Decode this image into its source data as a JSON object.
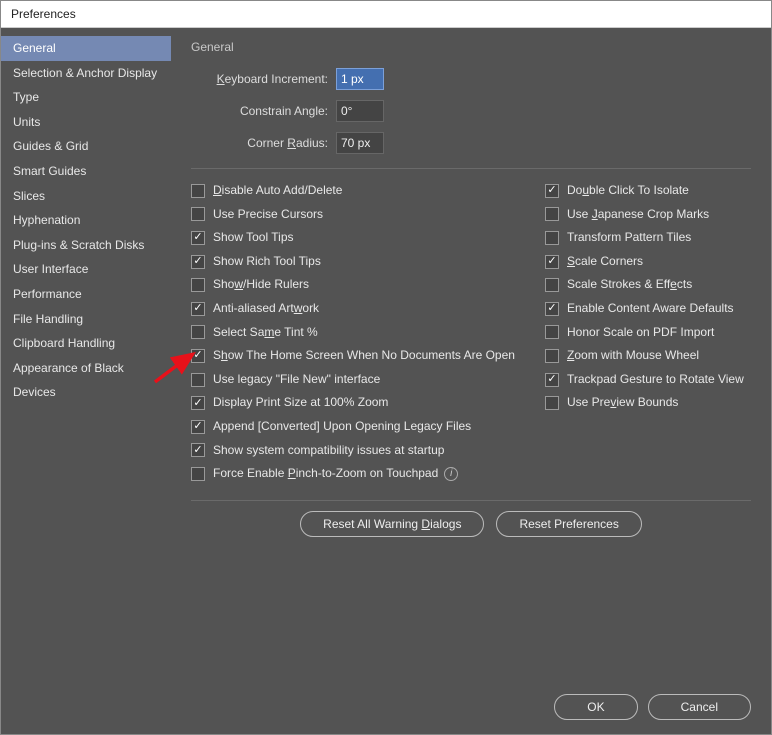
{
  "window": {
    "title": "Preferences"
  },
  "sidebar": {
    "items": [
      {
        "label": "General",
        "selected": true
      },
      {
        "label": "Selection & Anchor Display",
        "selected": false
      },
      {
        "label": "Type",
        "selected": false
      },
      {
        "label": "Units",
        "selected": false
      },
      {
        "label": "Guides & Grid",
        "selected": false
      },
      {
        "label": "Smart Guides",
        "selected": false
      },
      {
        "label": "Slices",
        "selected": false
      },
      {
        "label": "Hyphenation",
        "selected": false
      },
      {
        "label": "Plug-ins & Scratch Disks",
        "selected": false
      },
      {
        "label": "User Interface",
        "selected": false
      },
      {
        "label": "Performance",
        "selected": false
      },
      {
        "label": "File Handling",
        "selected": false
      },
      {
        "label": "Clipboard Handling",
        "selected": false
      },
      {
        "label": "Appearance of Black",
        "selected": false
      },
      {
        "label": "Devices",
        "selected": false
      }
    ]
  },
  "panel": {
    "title": "General",
    "fields": {
      "keyboard_increment": {
        "label_pre": "K",
        "label_post": "eyboard Increment:",
        "value": "1 px",
        "selected": true
      },
      "constrain_angle": {
        "label": "Constrain Angle:",
        "value": "0°",
        "selected": false
      },
      "corner_radius": {
        "label_pre": "Corner ",
        "label_u": "R",
        "label_post": "adius:",
        "value": "70 px",
        "selected": false
      }
    },
    "checks_left": [
      {
        "checked": false,
        "html": "<span class='u'>D</span>isable Auto Add/Delete"
      },
      {
        "checked": false,
        "html": "Use Precise Cursors"
      },
      {
        "checked": true,
        "html": "Show Tool Tips"
      },
      {
        "checked": true,
        "html": "Show Rich Tool Tips"
      },
      {
        "checked": false,
        "html": "Sho<span class='u'>w</span>/Hide Rulers"
      },
      {
        "checked": true,
        "html": "Anti-aliased Art<span class='u'>w</span>ork"
      },
      {
        "checked": false,
        "html": "Select Sa<span class='u'>m</span>e Tint %"
      },
      {
        "checked": true,
        "html": "S<span class='u'>h</span>ow The Home Screen When No Documents Are Open"
      },
      {
        "checked": false,
        "html": "Use legacy \"File New\" interface"
      },
      {
        "checked": true,
        "html": "Display Print Size at 100% Zoom"
      },
      {
        "checked": true,
        "html": "Append [Converted] Upon Opening Legacy Files"
      },
      {
        "checked": true,
        "html": "Show system compatibility issues at startup"
      },
      {
        "checked": false,
        "html": "Force Enable <span class='u'>P</span>inch-to-Zoom on Touchpad",
        "info": true
      }
    ],
    "checks_right": [
      {
        "checked": true,
        "html": "Do<span class='u'>u</span>ble Click To Isolate"
      },
      {
        "checked": false,
        "html": "Use <span class='u'>J</span>apanese Crop Marks"
      },
      {
        "checked": false,
        "html": "Transform Pattern Tiles"
      },
      {
        "checked": true,
        "html": "<span class='u'>S</span>cale Corners"
      },
      {
        "checked": false,
        "html": "Scale Strokes & Eff<span class='u'>e</span>cts"
      },
      {
        "checked": true,
        "html": "Enable Content Aware Defaults"
      },
      {
        "checked": false,
        "html": "Honor Scale on PDF Import"
      },
      {
        "checked": false,
        "html": "<span class='u'>Z</span>oom with Mouse Wheel"
      },
      {
        "checked": true,
        "html": "Trackpad Gesture to Rotate View"
      },
      {
        "checked": false,
        "html": "Use Pre<span class='u'>v</span>iew Bounds"
      }
    ],
    "buttons": {
      "reset_dialogs": "Reset All Warning Dialogs",
      "reset_prefs": "Reset Preferences"
    }
  },
  "footer": {
    "ok": "OK",
    "cancel": "Cancel"
  }
}
